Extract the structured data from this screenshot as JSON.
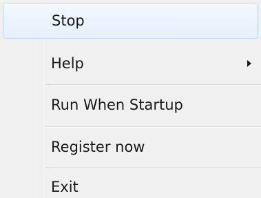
{
  "menu": {
    "items": [
      {
        "label": "Stop"
      },
      {
        "label": "Help"
      },
      {
        "label": "Run When Startup"
      },
      {
        "label": "Register now"
      },
      {
        "label": "Exit"
      }
    ]
  }
}
